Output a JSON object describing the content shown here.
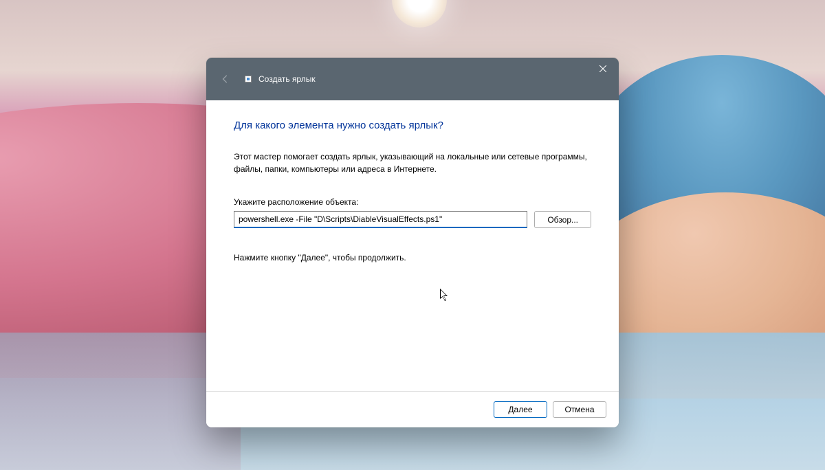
{
  "titlebar": {
    "title": "Создать ярлык"
  },
  "dialog": {
    "heading": "Для какого элемента нужно создать ярлык?",
    "description": "Этот мастер помогает создать ярлык, указывающий на локальные или сетевые программы, файлы, папки, компьютеры или адреса в Интернете.",
    "field_label": "Укажите расположение объекта:",
    "path_value": "powershell.exe -File \"D\\Scripts\\DiableVisualEffects.ps1\"",
    "browse_label": "Обзор...",
    "continue_text": "Нажмите кнопку \"Далее\", чтобы продолжить."
  },
  "footer": {
    "next_label": "Далее",
    "cancel_label": "Отмена"
  }
}
